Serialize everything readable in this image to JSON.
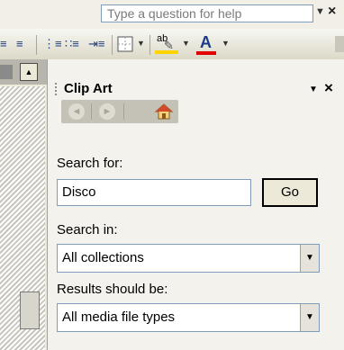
{
  "menubar": {
    "help_placeholder": "Type a question for help"
  },
  "toolbar": {
    "icons": [
      "align-justify-icon",
      "distributed-icon",
      "numbering-icon",
      "bullets-icon",
      "increase-indent-icon",
      "borders-icon",
      "highlight-icon",
      "font-color-icon"
    ],
    "highlight_label": "ab",
    "font_color_label": "A",
    "accent_highlight": "#ffd400",
    "accent_font_color": "#e00000"
  },
  "task_pane": {
    "title": "Clip Art",
    "search_for_label": "Search for:",
    "search_value": "Disco",
    "go_label": "Go",
    "search_in_label": "Search in:",
    "search_in_value": "All collections",
    "results_label": "Results should be:",
    "results_value": "All media file types"
  }
}
